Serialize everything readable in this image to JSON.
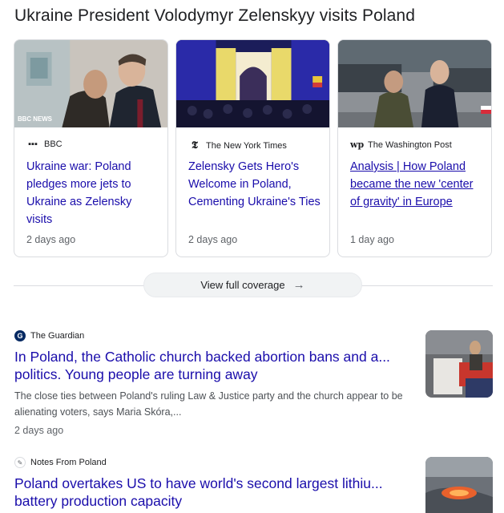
{
  "section_title": "Ukraine President Volodymyr Zelenskyy visits Poland",
  "cards": [
    {
      "source": "BBC",
      "source_icon": "bbc-logo-icon",
      "headline": "Ukraine war: Poland pledges more jets to Ukraine as Zelensky visits",
      "time": "2 days ago",
      "image_caption": "BBC NEWS"
    },
    {
      "source": "The New York Times",
      "source_icon": "nyt-logo-icon",
      "headline": "Zelensky Gets Hero's Welcome in Poland, Cementing Ukraine's Ties",
      "time": "2 days ago"
    },
    {
      "source": "The Washington Post",
      "source_icon": "wapo-logo-icon",
      "headline": "Analysis | How Poland became the new 'center of gravity' in Europe",
      "time": "1 day ago"
    }
  ],
  "view_full_coverage": "View full coverage",
  "stories": [
    {
      "source": "The Guardian",
      "title_line1": "In Poland, the Catholic church backed abortion bans and a...",
      "title_line2": "politics. Young people are turning away",
      "snippet": "The close ties between Poland's ruling Law & Justice party and the church appear to be alienating voters, says Maria Skóra,...",
      "time": "2 days ago"
    },
    {
      "source": "Notes From Poland",
      "title_line1": "Poland overtakes US to have world's second largest lithiu...",
      "title_line2": "battery production capacity"
    }
  ],
  "colors": {
    "link": "#1a0dab",
    "meta": "#5f6368",
    "border": "#dadce0"
  }
}
